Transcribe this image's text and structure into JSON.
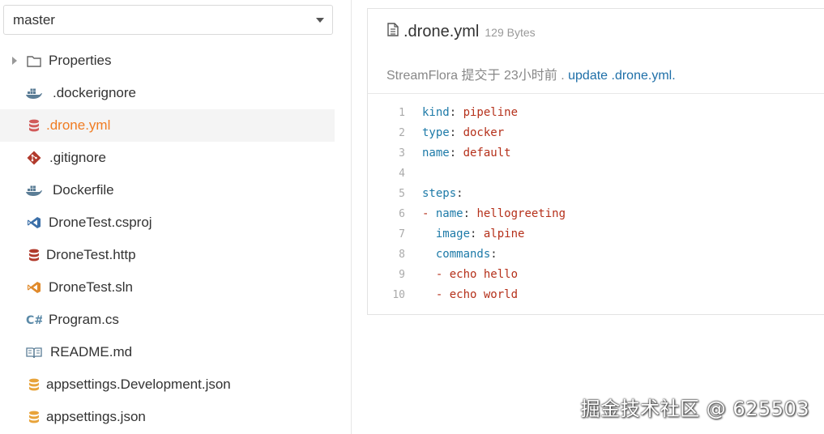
{
  "branch": {
    "selected": "master"
  },
  "tree": [
    {
      "label": "Properties",
      "icon": "folder-icon",
      "type": "folder"
    },
    {
      "label": ".dockerignore",
      "icon": "docker-icon",
      "type": "file"
    },
    {
      "label": ".drone.yml",
      "icon": "database-icon",
      "type": "file",
      "active": true
    },
    {
      "label": ".gitignore",
      "icon": "git-icon",
      "type": "file"
    },
    {
      "label": "Dockerfile",
      "icon": "docker-icon",
      "type": "file"
    },
    {
      "label": "DroneTest.csproj",
      "icon": "visualstudio-icon",
      "type": "file"
    },
    {
      "label": "DroneTest.http",
      "icon": "database-icon",
      "type": "file"
    },
    {
      "label": "DroneTest.sln",
      "icon": "visualstudio-icon",
      "type": "file"
    },
    {
      "label": "Program.cs",
      "icon": "csharp-icon",
      "type": "file"
    },
    {
      "label": "README.md",
      "icon": "book-icon",
      "type": "file"
    },
    {
      "label": "appsettings.Development.json",
      "icon": "database-icon",
      "type": "file"
    },
    {
      "label": "appsettings.json",
      "icon": "database-icon",
      "type": "file"
    }
  ],
  "file": {
    "name": ".drone.yml",
    "size": "129 Bytes",
    "commit_author": "StreamFlora",
    "commit_text": "提交于",
    "commit_time": "23小时前",
    "commit_sep": ".",
    "commit_message": "update .drone.yml."
  },
  "code": [
    {
      "n": "1",
      "key": "kind",
      "val": "pipeline"
    },
    {
      "n": "2",
      "key": "type",
      "val": "docker"
    },
    {
      "n": "3",
      "key": "name",
      "val": "default"
    },
    {
      "n": "4"
    },
    {
      "n": "5",
      "key": "steps",
      "val": ""
    },
    {
      "n": "6",
      "indent": "",
      "dash": "- ",
      "key": "name",
      "val": "hellogreeting"
    },
    {
      "n": "7",
      "indent": "  ",
      "key": "image",
      "val": "alpine"
    },
    {
      "n": "8",
      "indent": "  ",
      "key": "commands",
      "val": ""
    },
    {
      "n": "9",
      "indent": "  ",
      "dash": "- ",
      "plain": "echo hello"
    },
    {
      "n": "10",
      "indent": "  ",
      "dash": "- ",
      "plain": "echo world"
    }
  ],
  "watermark": "掘金技术社区 @ 625503",
  "colors": {
    "active": "#f07c22",
    "link": "#1e6fa8",
    "key": "#1d7aa8",
    "value": "#b5301a"
  }
}
